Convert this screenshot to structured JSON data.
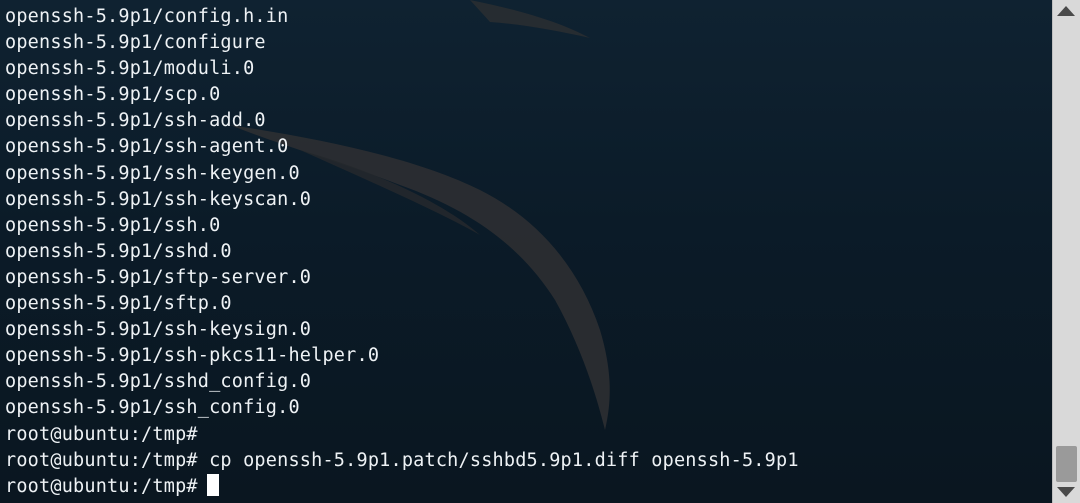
{
  "terminal": {
    "lines": [
      "openssh-5.9p1/config.h.in",
      "openssh-5.9p1/configure",
      "openssh-5.9p1/moduli.0",
      "openssh-5.9p1/scp.0",
      "openssh-5.9p1/ssh-add.0",
      "openssh-5.9p1/ssh-agent.0",
      "openssh-5.9p1/ssh-keygen.0",
      "openssh-5.9p1/ssh-keyscan.0",
      "openssh-5.9p1/ssh.0",
      "openssh-5.9p1/sshd.0",
      "openssh-5.9p1/sftp-server.0",
      "openssh-5.9p1/sftp.0",
      "openssh-5.9p1/ssh-keysign.0",
      "openssh-5.9p1/ssh-pkcs11-helper.0",
      "openssh-5.9p1/sshd_config.0",
      "openssh-5.9p1/ssh_config.0",
      "root@ubuntu:/tmp#",
      "root@ubuntu:/tmp# cp openssh-5.9p1.patch/sshbd5.9p1.diff openssh-5.9p1"
    ],
    "prompt": "root@ubuntu:/tmp#"
  },
  "colors": {
    "background": "#0c1a26",
    "text": "#eef2f5",
    "cursor": "#ffffff",
    "scrollbar": "#d9d9d9"
  },
  "icons": [
    "scroll-up-arrow-icon",
    "scroll-down-arrow-icon"
  ]
}
